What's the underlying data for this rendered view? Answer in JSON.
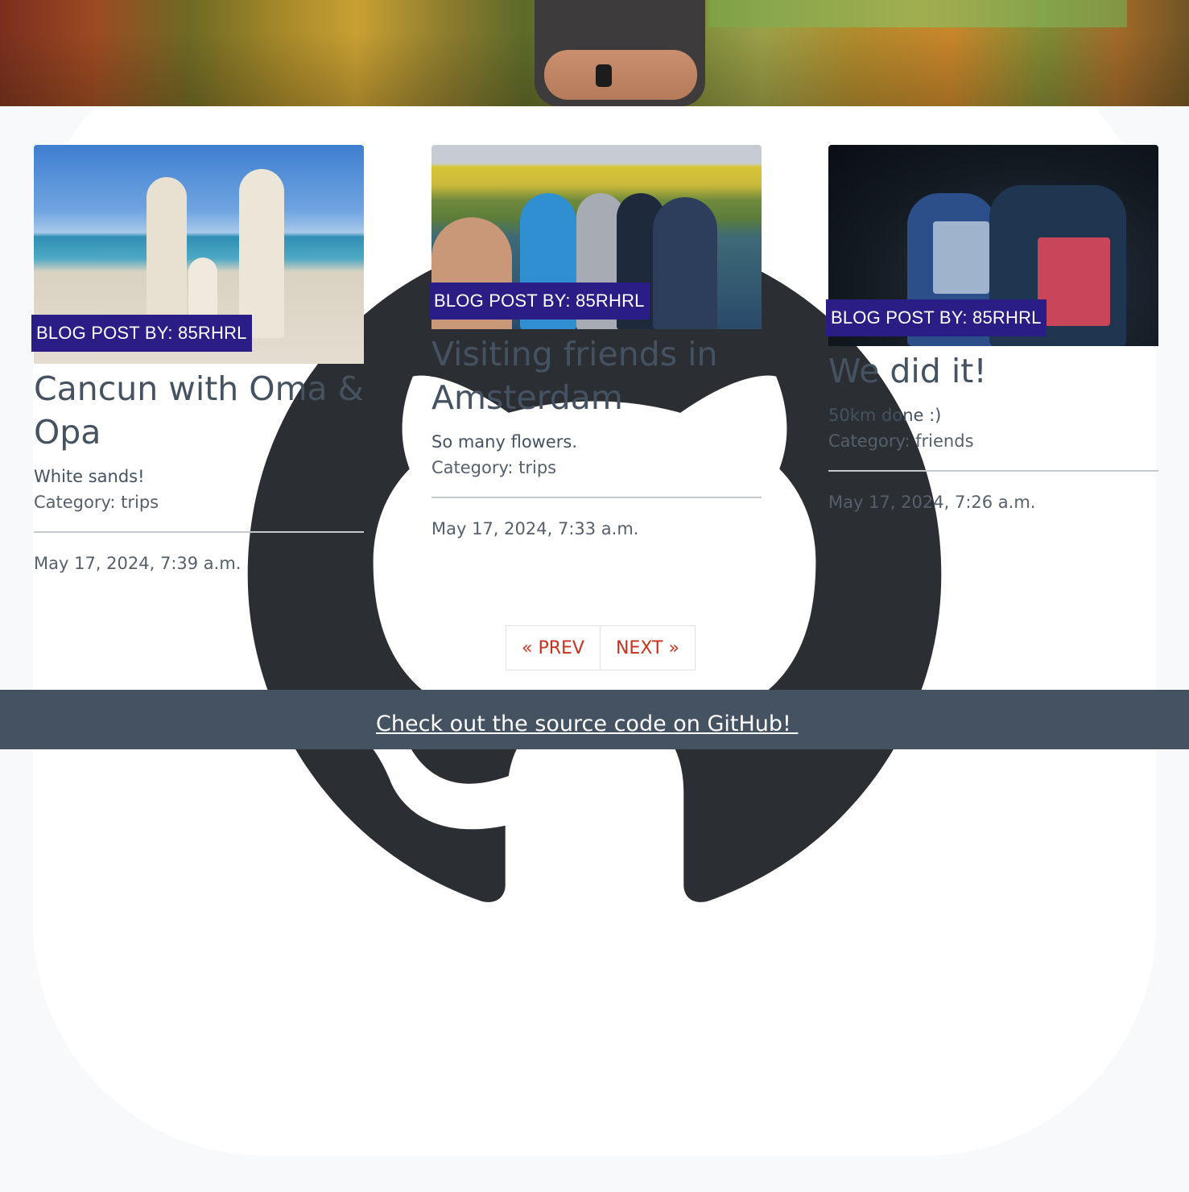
{
  "colors": {
    "accent_badge": "#2a1e86",
    "link_red": "#c8321e",
    "footer_bg": "#445261",
    "page_bg": "#f8f9fa"
  },
  "posts": [
    {
      "badge": "BLOG POST BY: 85RHRL",
      "title": "Cancun with Oma & Opa",
      "description": "White sands!",
      "category": "Category: trips",
      "date": "May 17, 2024, 7:39 a.m."
    },
    {
      "badge": "BLOG POST BY: 85RHRL",
      "title": "Visiting friends in Amsterdam",
      "description": "So many flowers.",
      "category": "Category: trips",
      "date": "May 17, 2024, 7:33 a.m."
    },
    {
      "badge": "BLOG POST BY: 85RHRL",
      "title": "We did it!",
      "description": "50km done :)",
      "category": "Category: friends",
      "date": "May 17, 2024, 7:26 a.m."
    }
  ],
  "pagination": {
    "prev_label": "« PREV",
    "next_label": "NEXT »"
  },
  "footer": {
    "link_text": "Check out the source code on GitHub! ",
    "icon": "github-icon"
  }
}
